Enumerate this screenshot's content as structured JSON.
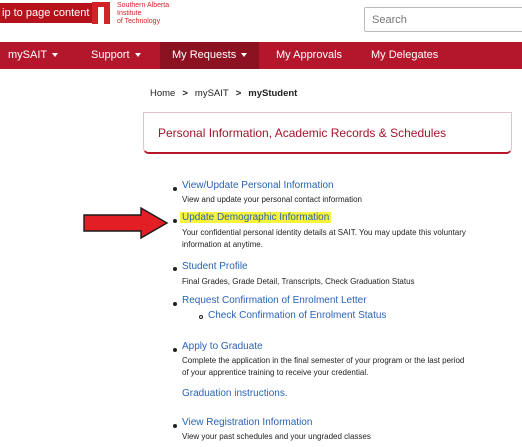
{
  "header": {
    "skip_link": "ip to page content",
    "logo_lines": [
      "Southern Alberta",
      "Institute",
      "of Technology"
    ],
    "search_placeholder": "Search"
  },
  "nav": {
    "items": [
      {
        "label": "mySAIT",
        "has_caret": true
      },
      {
        "label": "Support",
        "has_caret": true
      },
      {
        "label": "My Requests",
        "has_caret": true
      },
      {
        "label": "My Approvals",
        "has_caret": false
      },
      {
        "label": "My Delegates",
        "has_caret": false
      }
    ],
    "active": "My Requests"
  },
  "breadcrumb": {
    "home": "Home",
    "level2": "mySAIT",
    "current": "myStudent"
  },
  "card": {
    "title": "Personal Information, Academic Records & Schedules"
  },
  "links": [
    {
      "label": "View/Update Personal Information",
      "desc": [
        "View and update your personal contact information"
      ]
    },
    {
      "label": "Update Demographic Information",
      "highlighted": true,
      "desc": [
        "Your confidential personal identity details at SAIT. You may update this voluntary",
        "information at anytime."
      ]
    },
    {
      "label": "Student Profile",
      "desc": [
        "Final Grades, Grade Detail, Transcripts, Check Graduation Status"
      ]
    },
    {
      "label": "Request Confirmation of Enrolment Letter",
      "sub": "Check Confirmation of Enrolment Status"
    },
    {
      "label": "Apply to Graduate",
      "desc": [
        "Complete the application in the final semester of your program or the last period",
        "of your apprentice training to receive your credential."
      ],
      "extra_link": "Graduation instructions."
    },
    {
      "label": "View Registration Information",
      "desc": [
        "View your past schedules and your ungraded classes"
      ]
    }
  ],
  "colors": {
    "brand_red": "#b4172c",
    "link_blue": "#2a63b5",
    "highlight": "#f5f33a",
    "arrow_red": "#e31e24"
  }
}
